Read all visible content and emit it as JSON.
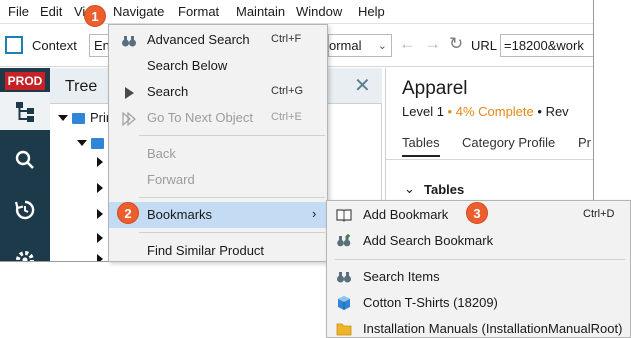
{
  "menubar": {
    "items": [
      "File",
      "Edit",
      "Vi",
      "Navigate",
      "Format",
      "Maintain",
      "Window",
      "Help"
    ]
  },
  "toolbar": {
    "context_label": "Context",
    "context_value": "En",
    "view_value": "ormal",
    "url_label": "URL",
    "url_value": "=18200&work"
  },
  "sidebar": {
    "env_badge": "PROD",
    "icons": [
      "tree-icon",
      "search-icon",
      "history-icon",
      "settings-icon"
    ]
  },
  "tree": {
    "title": "Tree",
    "root_label": "Prin"
  },
  "details": {
    "title": "Apparel",
    "level": "Level 1",
    "completion": "4% Complete",
    "sub_rest": "Rev",
    "tabs": [
      "Tables",
      "Category Profile",
      "Pr"
    ],
    "section": "Tables"
  },
  "navigate_menu": {
    "items": [
      {
        "label": "Advanced Search",
        "shortcut": "Ctrl+F",
        "icon": "binoculars-icon",
        "disabled": false
      },
      {
        "label": "Search Below",
        "shortcut": "",
        "icon": "",
        "disabled": false
      },
      {
        "label": "Search",
        "shortcut": "Ctrl+G",
        "icon": "play-icon",
        "disabled": false
      },
      {
        "label": "Go To Next Object",
        "shortcut": "Ctrl+E",
        "icon": "skip-next-icon",
        "disabled": true
      },
      {
        "label": "Back",
        "shortcut": "",
        "icon": "",
        "disabled": true
      },
      {
        "label": "Forward",
        "shortcut": "",
        "icon": "",
        "disabled": true
      },
      {
        "label": "Bookmarks",
        "shortcut": "",
        "icon": "",
        "disabled": false
      },
      {
        "label": "Find Similar Product",
        "shortcut": "",
        "icon": "",
        "disabled": false
      }
    ]
  },
  "bookmarks_menu": {
    "items": [
      {
        "label": "Add Bookmark",
        "shortcut": "Ctrl+D",
        "icon": "book-add-icon"
      },
      {
        "label": "Add Search Bookmark",
        "shortcut": "",
        "icon": "binoculars-add-icon"
      },
      {
        "label": "Search Items",
        "shortcut": "",
        "icon": "binoculars-icon"
      },
      {
        "label": "Cotton T-Shirts (18209)",
        "shortcut": "",
        "icon": "cube-icon"
      },
      {
        "label": "Installation Manuals (InstallationManualRoot)",
        "shortcut": "",
        "icon": "folder-icon"
      }
    ]
  },
  "callouts": [
    "1",
    "2",
    "3"
  ],
  "colors": {
    "callout": "#ec5e2e",
    "highlight": "#c4dcf3",
    "sidebar": "#1c3a4a",
    "badge": "#c62127",
    "completion": "#e38a15"
  }
}
